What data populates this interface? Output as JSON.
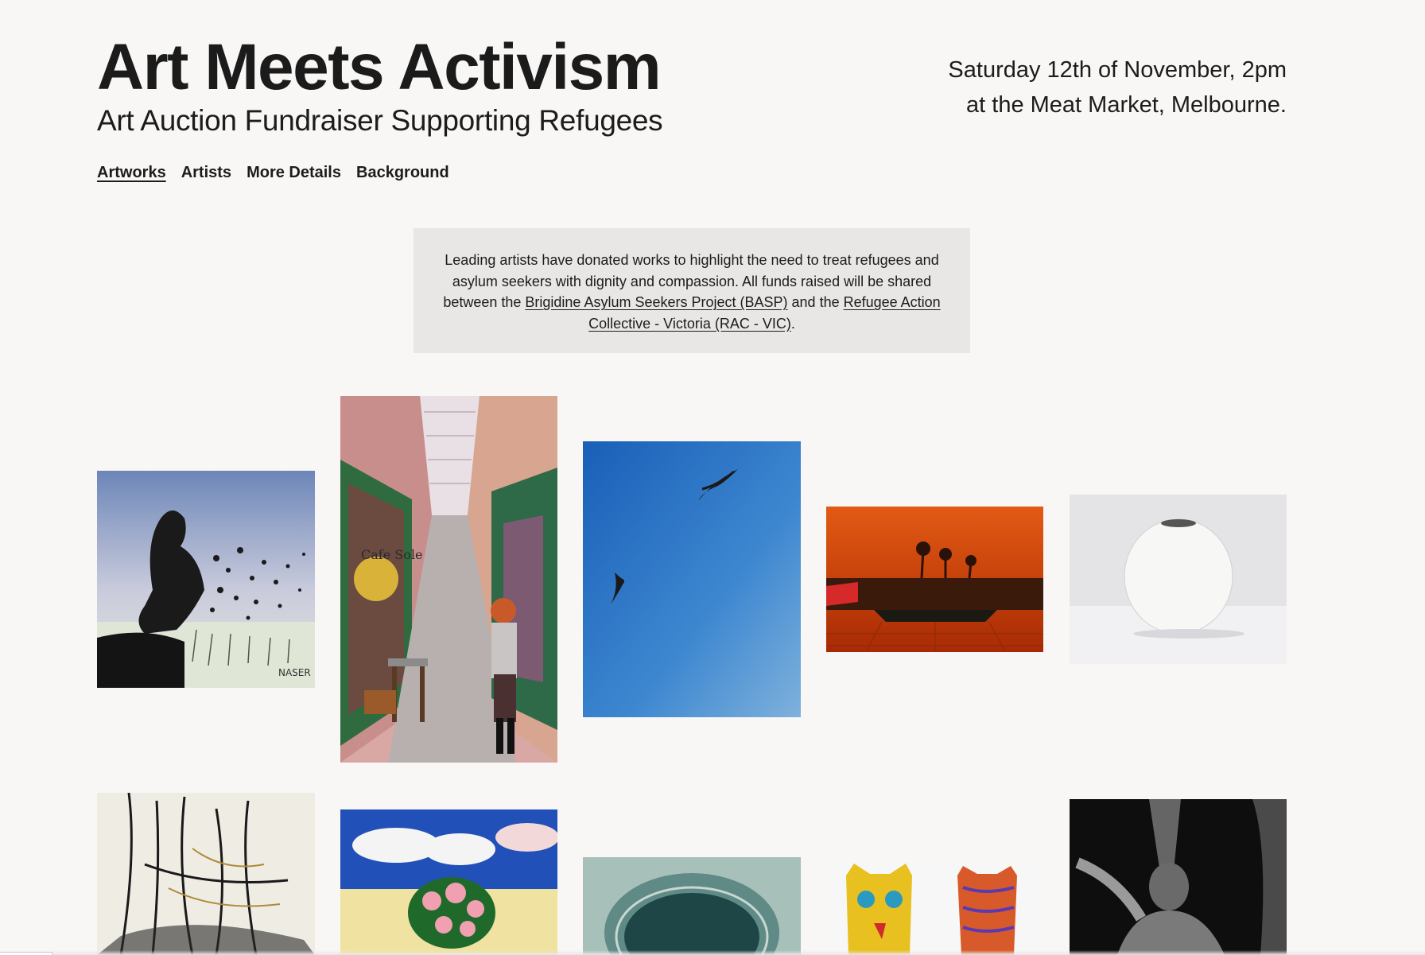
{
  "header": {
    "title": "Art Meets Activism",
    "subtitle": "Art Auction Fundraiser Supporting Refugees"
  },
  "event": {
    "line1": "Saturday 12th of November, 2pm",
    "line2": "at the Meat Market, Melbourne."
  },
  "nav": {
    "items": [
      {
        "label": "Artworks",
        "active": true
      },
      {
        "label": "Artists"
      },
      {
        "label": "More Details"
      },
      {
        "label": "Background"
      }
    ]
  },
  "intro": {
    "text_before": "Leading artists have donated works to highlight the need to treat refugees and asylum seekers with dignity and compassion. All funds raised will be shared between the ",
    "link1": "Brigidine Asylum Seekers Project (BASP)",
    "text_middle": " and the ",
    "link2": "Refugee Action Collective - Victoria (RAC - VIC)",
    "text_after": "."
  },
  "artworks": {
    "signature_naser": "NASER",
    "cafe_text": "Cafe Sole"
  },
  "colors": {
    "background": "#f8f7f5",
    "intro_box": "#e8e7e6",
    "text": "#1c1c1c"
  }
}
